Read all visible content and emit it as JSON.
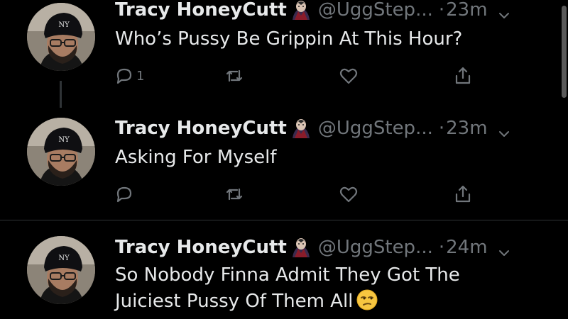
{
  "tweets": [
    {
      "name": "Tracy HoneyCutt",
      "handle": "@UggStep...",
      "separator": "·",
      "time": "23m",
      "text": "Who’s Pussy Be Grippin At This Hour?",
      "text_emoji": "",
      "reply_count": "1",
      "badge_icon": "vampire-emoji-icon"
    },
    {
      "name": "Tracy HoneyCutt",
      "handle": "@UggStep...",
      "separator": "·",
      "time": "23m",
      "text": "Asking For Myself",
      "text_emoji": "",
      "reply_count": "",
      "badge_icon": "vampire-emoji-icon"
    },
    {
      "name": "Tracy HoneyCutt",
      "handle": "@UggStep...",
      "separator": "·",
      "time": "24m",
      "text": "So Nobody Finna Admit They Got The Juiciest Pussy Of Them All",
      "text_emoji": "unamused-face-emoji",
      "reply_count": "",
      "badge_icon": "vampire-emoji-icon"
    }
  ],
  "colors": {
    "background": "#000000",
    "primary_text": "#e7e9ea",
    "secondary_text": "#71767b",
    "divider": "#2f3336"
  }
}
